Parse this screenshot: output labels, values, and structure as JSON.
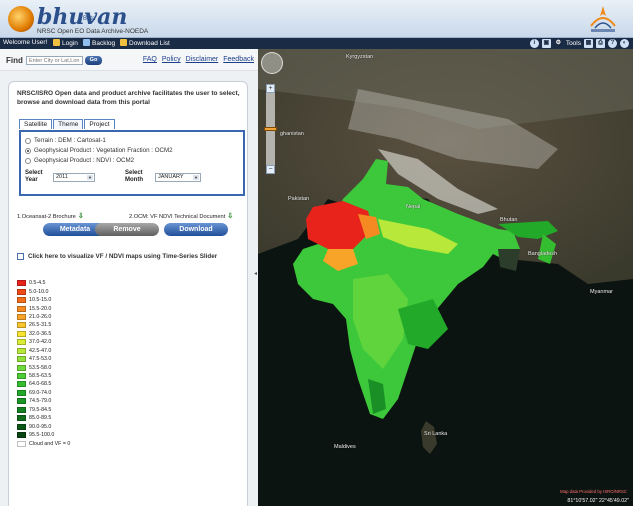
{
  "header": {
    "logo_text": "bhuvan",
    "logo_sub": "Beta",
    "tagline": "NRSC Open EO Data Archive-NOEDA"
  },
  "menubar": {
    "welcome": "Welcome User!",
    "login": "Login",
    "backlog": "Backlog",
    "download_list": "Download List",
    "tools": "Tools"
  },
  "find": {
    "label": "Find",
    "placeholder": "Enter City or Lat,Lon",
    "go": "Go"
  },
  "toplinks": [
    "FAQ",
    "Policy",
    "Disclaimer",
    "Feedback"
  ],
  "intro": "NRSC/ISRO Open data and product archive facilitates the user to select, browse and download data from this portal",
  "tabs": [
    "Satellite",
    "Theme",
    "Project"
  ],
  "theme_options": [
    "Terrain : DEM : Cartosat-1",
    "Geophysical Product : Vegetation Fraction : OCM2",
    "Geophysical Product : NDVI : OCM2"
  ],
  "select_year_label": "Select Year",
  "select_year_value": "2011",
  "select_month_label": "Select Month",
  "select_month_value": "JANUARY",
  "docs": {
    "left": "1.Oceansat-2 Brochure",
    "right": "2.OCM: VF NDVI Technical Document"
  },
  "buttons": {
    "metadata": "Metadata",
    "remove": "Remove",
    "download": "Download"
  },
  "vf_check_label": "Click here to visualize VF / NDVI maps using Time-Series Slider",
  "legend": [
    {
      "label": "0.5-4.5",
      "color": "#e8231c"
    },
    {
      "label": "5.0-10.0",
      "color": "#ee4a18"
    },
    {
      "label": "10.5-15.0",
      "color": "#f36d1d"
    },
    {
      "label": "15.5-20.0",
      "color": "#f58a23"
    },
    {
      "label": "21.0-26.0",
      "color": "#f7a428"
    },
    {
      "label": "26.5-31.5",
      "color": "#f9c52c"
    },
    {
      "label": "32.0-36.5",
      "color": "#f7e230"
    },
    {
      "label": "37.0-42.0",
      "color": "#d9ec37"
    },
    {
      "label": "42.5-47.0",
      "color": "#b8e83a"
    },
    {
      "label": "47.5-53.0",
      "color": "#93e03a"
    },
    {
      "label": "53.5-58.0",
      "color": "#6fd83a"
    },
    {
      "label": "58.5-63.5",
      "color": "#4ccd36"
    },
    {
      "label": "64.0-68.5",
      "color": "#35bd30"
    },
    {
      "label": "69.0-74.0",
      "color": "#23a92a"
    },
    {
      "label": "74.5-79.0",
      "color": "#1a9526"
    },
    {
      "label": "79.5-84.5",
      "color": "#158022"
    },
    {
      "label": "85.0-89.5",
      "color": "#106b1d"
    },
    {
      "label": "90.0-95.0",
      "color": "#0b5718"
    },
    {
      "label": "95.5-100.0",
      "color": "#074413"
    },
    {
      "label": "Cloud and VF = 0",
      "color": "#ffffff"
    }
  ],
  "map_labels": {
    "kyrgyzstan": "Kyrgyzstan",
    "afghanistan": "ghanistan",
    "pakistan": "Pakistan",
    "nepal": "Nepal",
    "bhutan": "Bhutan",
    "bangladesh": "Bangladesh",
    "myanmar": "Myanmar",
    "sri_lanka": "Sri Lanka",
    "maldives": "Maldives"
  },
  "map_copyright": "Map data Provided by ISRO/NRSC",
  "map_coords": "81°10'57.02\" 22°45'49.02\""
}
